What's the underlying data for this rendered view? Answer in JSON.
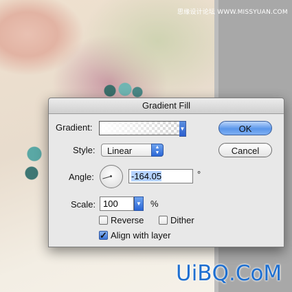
{
  "watermark": {
    "top_text": "思缘设计论坛 WWW.MISSYUAN.COM",
    "bottom_text": "UiBQ.CoM"
  },
  "dialog": {
    "title": "Gradient Fill",
    "gradient_label": "Gradient:",
    "gradient_arrow_icon": "triangle-down-icon",
    "style_label": "Style:",
    "style_value": "Linear",
    "angle_label": "Angle:",
    "angle_value": "-164.05",
    "degree_symbol": "°",
    "scale_label": "Scale:",
    "scale_value": "100",
    "percent_symbol": "%",
    "reverse_label": "Reverse",
    "reverse_checked": false,
    "dither_label": "Dither",
    "dither_checked": false,
    "align_label": "Align with layer",
    "align_checked": true,
    "ok_label": "OK",
    "cancel_label": "Cancel"
  },
  "colors": {
    "accent": "#3b73d6",
    "dialog_bg": "#e8e8e8",
    "watermark": "#1e6fd0"
  }
}
